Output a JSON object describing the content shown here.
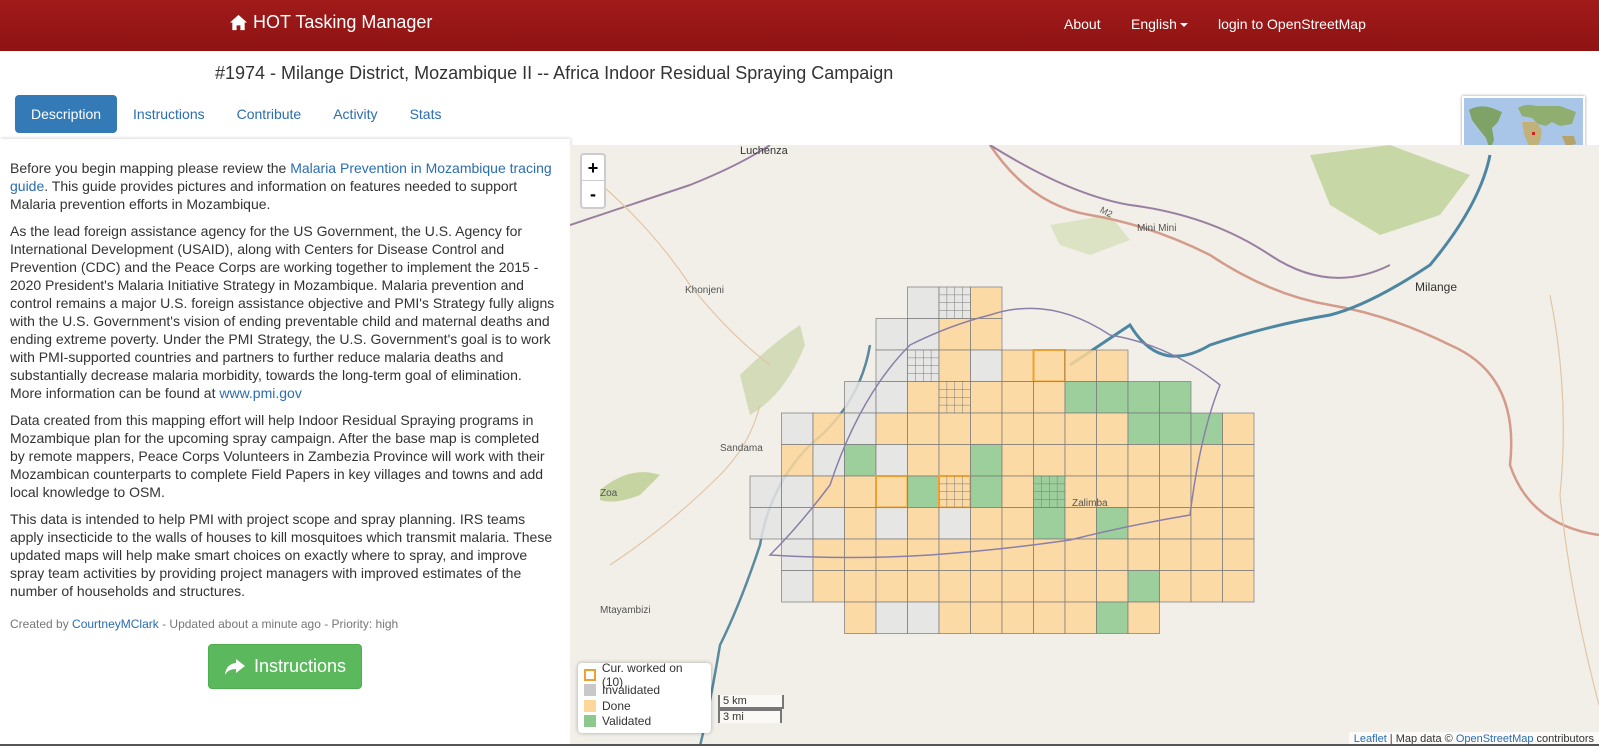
{
  "navbar": {
    "brand": "HOT Tasking Manager",
    "about": "About",
    "language": "English",
    "login": "login to OpenStreetMap"
  },
  "project": {
    "title": "#1974 - Milange District, Mozambique II -- Africa Indoor Residual Spraying Campaign"
  },
  "tabs": [
    {
      "label": "Description",
      "active": true
    },
    {
      "label": "Instructions",
      "active": false
    },
    {
      "label": "Contribute",
      "active": false
    },
    {
      "label": "Activity",
      "active": false
    },
    {
      "label": "Stats",
      "active": false
    }
  ],
  "description": {
    "p1_pre": "Before you begin mapping please review the ",
    "p1_link": "Malaria Prevention in Mozambique tracing guide",
    "p1_post": ". This guide provides pictures and information on features needed to support Malaria prevention efforts in Mozambique.",
    "p2_pre": "As the lead foreign assistance agency for the US Government, the U.S. Agency for International Development (USAID), along with Centers for Disease Control and Prevention (CDC) and the Peace Corps are working together to implement the 2015 - 2020 President's Malaria Initiative Strategy in Mozambique. Malaria prevention and control remains a major U.S. foreign assistance objective and PMI's Strategy fully aligns with the U.S. Government's vision of ending preventable child and maternal deaths and ending extreme poverty. Under the PMI Strategy, the U.S. Government's goal is to work with PMI-supported countries and partners to further reduce malaria deaths and substantially decrease malaria morbidity, towards the long-term goal of elimination. More information can be found at ",
    "p2_link": "www.pmi.gov",
    "p3": "Data created from this mapping effort will help Indoor Residual Spraying programs in Mozambique plan for the upcoming spray campaign. After the base map is completed by remote mappers, Peace Corps Volunteers in Zambezia Province will work with their Mozambican counterparts to complete Field Papers in key villages and towns and add local knowledge to OSM.",
    "p4": "This data is intended to help PMI with project scope and spray planning. IRS teams apply insecticide to the walls of houses to kill mosquitoes which transmit malaria. These updated maps will help make smart choices on exactly where to spray, and improve spray team activities by providing project managers with improved estimates of the number of households and structures."
  },
  "meta": {
    "created_by_label": "Created by ",
    "author": "CourtneyMClark",
    "updated": " - Updated about a minute ago - Priority: high"
  },
  "instructions_button": "Instructions",
  "map": {
    "zoom_in": "+",
    "zoom_out": "-",
    "places": [
      "Luchenza",
      "Milange",
      "Khonjeni",
      "Mini Mini",
      "Sandama",
      "Zoa",
      "Zalimba",
      "Mtayambizi",
      "M2"
    ],
    "legend": [
      {
        "label": "Cur. worked on (10)",
        "color": "#ffffff",
        "border": "#f0a030"
      },
      {
        "label": "Invalidated",
        "color": "#c8c8c8",
        "border": "#c8c8c8"
      },
      {
        "label": "Done",
        "color": "#fdd69a",
        "border": "#fdd69a"
      },
      {
        "label": "Validated",
        "color": "#8dc98d",
        "border": "#8dc98d"
      }
    ],
    "scale_km": "5 km",
    "scale_mi": "3 mi",
    "attribution_leaflet": "Leaflet",
    "attribution_mid": " | Map data © ",
    "attribution_osm": "OpenStreetMap",
    "attribution_post": " contributors"
  },
  "colors": {
    "navbar": "#9b1717",
    "done": "#fdd69a",
    "validated": "#8dc98d",
    "invalidated": "#d4d4d4",
    "working": "#f0a030",
    "link": "#2a6db0",
    "button_green": "#5cb85c"
  }
}
